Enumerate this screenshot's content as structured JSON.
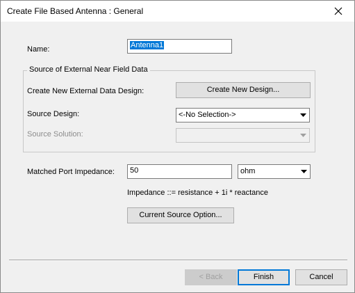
{
  "window": {
    "title": "Create File Based Antenna : General"
  },
  "form": {
    "name_label": "Name:",
    "name_value": "Antenna1",
    "group_title": "Source of External Near Field Data",
    "create_new_label": "Create New External Data Design:",
    "create_new_button": "Create New Design...",
    "source_design_label": "Source Design:",
    "source_design_value": "<-No Selection->",
    "source_solution_label": "Source Solution:",
    "source_solution_value": "",
    "impedance_label": "Matched Port Impedance:",
    "impedance_value": "50",
    "impedance_unit": "ohm",
    "impedance_hint": "Impedance ::= resistance + 1i * reactance",
    "current_source_button": "Current Source Option..."
  },
  "footer": {
    "back_label": "< Back",
    "finish_label": "Finish",
    "cancel_label": "Cancel"
  }
}
